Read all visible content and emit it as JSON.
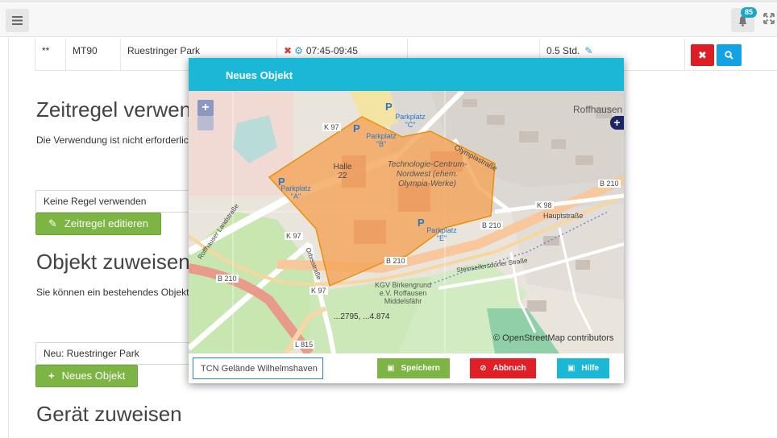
{
  "topbar": {
    "notification_count": "85",
    "icons": [
      "menu-icon",
      "bell-icon",
      "expand-icon"
    ]
  },
  "table": {
    "row": {
      "marker": "**",
      "code": "MT90",
      "name": "Ruestringer Park",
      "time": "07:45-09:45",
      "duration": "0.5 Std."
    }
  },
  "sections": {
    "zeitregel": {
      "title": "Zeitregel verwenden",
      "description": "Die Verwendung ist nicht erforderlich",
      "select_value": "Keine Regel verwenden",
      "edit_button": "Zeitregel editieren"
    },
    "objekt": {
      "title": "Objekt zuweisen",
      "description": "Sie können ein bestehendes Objekt",
      "select_value": "Neu: Ruestringer Park",
      "new_button": "Neues Objekt"
    },
    "geraet": {
      "title": "Gerät zuweisen"
    }
  },
  "modal": {
    "title": "Neues Objekt",
    "name_value": "TCN Gelände Wilhelmshaven",
    "save_button": "Speichern",
    "cancel_button": "Abbruch",
    "help_button": "Hilfe",
    "coords_text": "...2795, ...4.874"
  },
  "map": {
    "attribution": "© OpenStreetMap contributors",
    "labels": {
      "roffhausen": "Roffhausen",
      "parkplatz_a": "Parkplatz \"A\"",
      "parkplatz_b": "Parkplatz \"B\"",
      "parkplatz_c": "Parkplatz \"C\"",
      "parkplatz_e": "Parkplatz \"E\"",
      "halle": "Halle 22",
      "technologie": "Technologie-Centrum-Nordwest (ehem. Olympia-Werke)",
      "kgv": "KGV Birkengrund e.V. Roffausen Middelsfähr",
      "k97a": "K 97",
      "k97b": "K 97",
      "k97c": "K 97",
      "k98": "K 98",
      "b210a": "B 210",
      "b210b": "B 210",
      "b210c": "B 210",
      "b210d": "B 210",
      "l815": "L 815",
      "hauptstrasse": "Hauptstraße",
      "olympiastrasse": "Olympiastraße",
      "steinseifersdorfer": "Steinseifersdorfer Straße",
      "roffhauser_landstrasse": "Roffhauser Landstraße",
      "orbisstrasse": "Orbisstraße"
    },
    "colors": {
      "polygon_fill": "#f4a65c",
      "polygon_stroke": "#e8900e",
      "green": "#c8e6b0",
      "road_major": "#f8c79b",
      "road_b210": "#e89b8b"
    }
  },
  "colors": {
    "accent": "#1ab8d6",
    "green_button": "#7db544",
    "red_button": "#e01f26",
    "blue_button": "#14a2e6"
  }
}
